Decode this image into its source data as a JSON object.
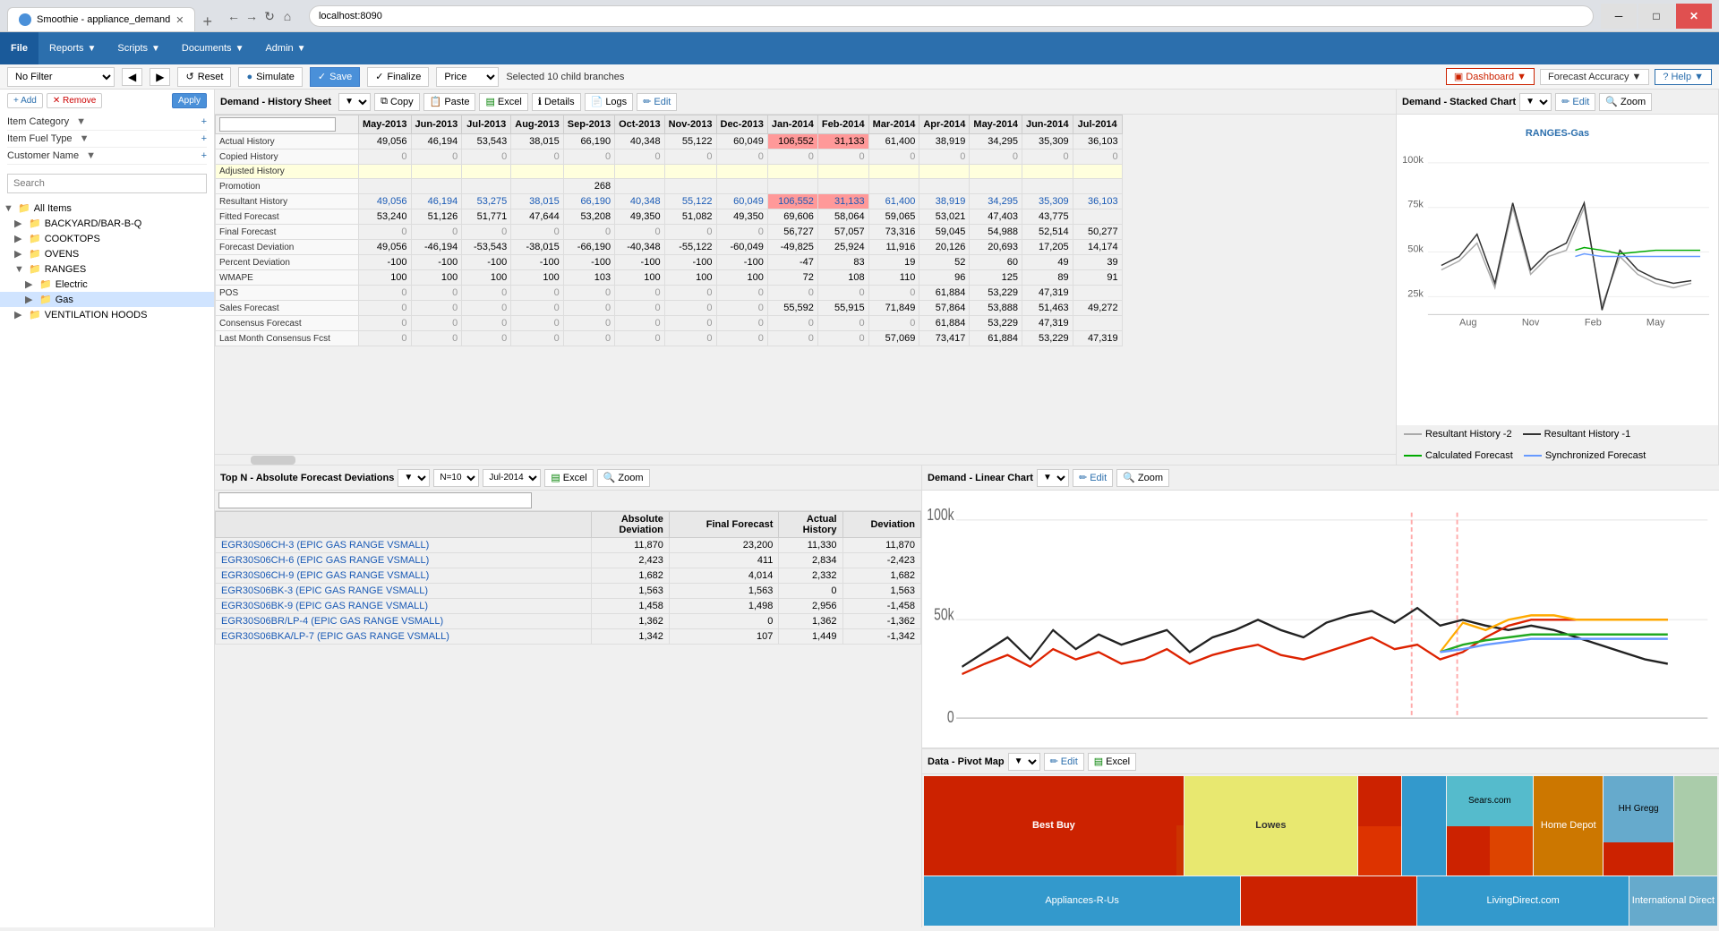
{
  "browser": {
    "tab_title": "Smoothie - appliance_demand",
    "url": "localhost:8090",
    "new_tab_label": "+"
  },
  "nav": {
    "logo": "File",
    "items": [
      {
        "label": "Reports",
        "dropdown": true
      },
      {
        "label": "Scripts",
        "dropdown": true
      },
      {
        "label": "Documents",
        "dropdown": true
      },
      {
        "label": "Admin",
        "dropdown": true
      }
    ]
  },
  "filter_bar": {
    "filter_value": "No Filter",
    "back_arrow": "◀",
    "forward_arrow": "▶",
    "reset_label": "Reset",
    "simulate_label": "Simulate",
    "save_label": "Save",
    "finalize_label": "Finalize",
    "price_label": "Price",
    "branches_label": "Selected 10 child branches",
    "dashboard_label": "Dashboard",
    "forecast_accuracy_label": "Forecast Accuracy",
    "help_label": "Help"
  },
  "sidebar": {
    "add_label": "+ Add",
    "remove_label": "✕ Remove",
    "apply_label": "Apply",
    "search_placeholder": "Search",
    "filters": [
      {
        "label": "Item Category",
        "dropdown": true
      },
      {
        "label": "Item Fuel Type",
        "dropdown": true
      },
      {
        "label": "Customer Name",
        "dropdown": true
      }
    ],
    "tree": [
      {
        "label": "All Items",
        "level": 0,
        "expanded": true,
        "type": "root"
      },
      {
        "label": "BACKYARD/BAR-B-Q",
        "level": 1,
        "expanded": false,
        "type": "folder"
      },
      {
        "label": "COOKTOPS",
        "level": 1,
        "expanded": false,
        "type": "folder"
      },
      {
        "label": "OVENS",
        "level": 1,
        "expanded": false,
        "type": "folder"
      },
      {
        "label": "RANGES",
        "level": 1,
        "expanded": true,
        "type": "folder"
      },
      {
        "label": "Electric",
        "level": 2,
        "expanded": false,
        "type": "folder"
      },
      {
        "label": "Gas",
        "level": 2,
        "expanded": false,
        "type": "folder",
        "selected": true
      },
      {
        "label": "VENTILATION HOODS",
        "level": 1,
        "expanded": false,
        "type": "folder"
      }
    ]
  },
  "history_sheet": {
    "title": "Demand - History Sheet",
    "copy_label": "Copy",
    "paste_label": "Paste",
    "excel_label": "Excel",
    "details_label": "Details",
    "logs_label": "Logs",
    "edit_label": "Edit",
    "columns": [
      "",
      "May-2013",
      "Jun-2013",
      "Jul-2013",
      "Aug-2013",
      "Sep-2013",
      "Oct-2013",
      "Nov-2013",
      "Dec-2013",
      "Jan-2014",
      "Feb-2014",
      "Mar-2014",
      "Apr-2014",
      "May-2014",
      "Jun-2014",
      "Jul-2014"
    ],
    "rows": [
      {
        "label": "Actual History",
        "values": [
          "49,056",
          "46,194",
          "53,543",
          "38,015",
          "66,190",
          "40,348",
          "55,122",
          "60,049",
          "106,552",
          "31,133",
          "61,400",
          "38,919",
          "34,295",
          "35,309",
          "36,103"
        ],
        "style": ""
      },
      {
        "label": "Copied History",
        "values": [
          "0",
          "0",
          "0",
          "0",
          "0",
          "0",
          "0",
          "0",
          "0",
          "0",
          "0",
          "0",
          "0",
          "0",
          "0"
        ],
        "style": ""
      },
      {
        "label": "Adjusted History",
        "values": [
          "",
          "",
          "",
          "",
          "",
          "",
          "",
          "",
          "",
          "",
          "",
          "",
          "",
          "",
          ""
        ],
        "style": "yellow"
      },
      {
        "label": "Promotion",
        "values": [
          "",
          "",
          "",
          "",
          "268",
          "",
          "",
          "",
          "",
          "",
          "",
          "",
          "",
          "",
          ""
        ],
        "style": ""
      },
      {
        "label": "Resultant History",
        "values": [
          "49,056",
          "46,194",
          "53,275",
          "38,015",
          "66,190",
          "40,348",
          "55,122",
          "60,049",
          "106,552",
          "31,133",
          "61,400",
          "38,919",
          "34,295",
          "35,309",
          "36,103"
        ],
        "style": "blue"
      },
      {
        "label": "Fitted Forecast",
        "values": [
          "53,240",
          "51,126",
          "51,771",
          "47,644",
          "53,208",
          "49,350",
          "",
          "",
          "69,606",
          "58,064",
          "59,065",
          "53,021",
          "47,403",
          "43,775",
          ""
        ],
        "style": ""
      },
      {
        "label": "Final Forecast",
        "values": [
          "0",
          "0",
          "0",
          "0",
          "0",
          "0",
          "0",
          "0",
          "56,727",
          "57,057",
          "73,316",
          "59,045",
          "54,988",
          "52,514",
          "50,277"
        ],
        "style": ""
      },
      {
        "label": "Forecast Deviation",
        "values": [
          "49,056",
          "-46,194",
          "-53,543",
          "-38,015",
          "-66,190",
          "-40,348",
          "-55,122",
          "-60,049",
          "-49,825",
          "25,924",
          "11,916",
          "20,126",
          "20,693",
          "17,205",
          "14,174"
        ],
        "style": ""
      },
      {
        "label": "Percent Deviation",
        "values": [
          "-100",
          "-100",
          "-100",
          "-100",
          "-100",
          "-100",
          "-100",
          "-100",
          "-47",
          "83",
          "19",
          "52",
          "60",
          "49",
          "39"
        ],
        "style": ""
      },
      {
        "label": "WMAPE",
        "values": [
          "100",
          "100",
          "100",
          "100",
          "103",
          "100",
          "100",
          "100",
          "72",
          "108",
          "110",
          "96",
          "125",
          "89",
          "91"
        ],
        "style": ""
      },
      {
        "label": "POS",
        "values": [
          "0",
          "0",
          "0",
          "0",
          "0",
          "0",
          "0",
          "0",
          "0",
          "0",
          "0",
          "61,884",
          "53,229",
          "47,319",
          ""
        ],
        "style": ""
      },
      {
        "label": "Sales Forecast",
        "values": [
          "0",
          "0",
          "0",
          "0",
          "0",
          "0",
          "0",
          "0",
          "55,592",
          "55,915",
          "71,849",
          "57,864",
          "53,888",
          "51,463",
          "49,272"
        ],
        "style": ""
      },
      {
        "label": "Consensus Forecast",
        "values": [
          "0",
          "0",
          "0",
          "0",
          "0",
          "0",
          "0",
          "0",
          "0",
          "0",
          "0",
          "61,884",
          "53,229",
          "47,319",
          ""
        ],
        "style": ""
      },
      {
        "label": "Last Month Consensus Fcst",
        "values": [
          "0",
          "0",
          "0",
          "0",
          "0",
          "0",
          "0",
          "0",
          "0",
          "0",
          "57,069",
          "73,417",
          "61,884",
          "53,229",
          "47,319"
        ],
        "style": ""
      }
    ]
  },
  "stacked_chart": {
    "title": "Demand - Stacked Chart",
    "edit_label": "Edit",
    "zoom_label": "Zoom",
    "chart_title": "RANGES-Gas",
    "y_labels": [
      "100k",
      "75k",
      "50k",
      "25k"
    ],
    "x_labels": [
      "Aug",
      "Nov",
      "Feb",
      "May"
    ],
    "legend": [
      {
        "label": "Resultant History -2",
        "color": "#999999"
      },
      {
        "label": "Resultant History -1",
        "color": "#333333"
      },
      {
        "label": "Calculated Forecast",
        "color": "#00aa00"
      },
      {
        "label": "Synchronized Forecast",
        "color": "#6699ff"
      }
    ]
  },
  "deviations": {
    "title": "Top Absolute Forecast Deviations",
    "top_n_label": "Top N - Absolute Forecast Deviations",
    "n_label": "N=10",
    "date_label": "Jul-2014",
    "excel_label": "Excel",
    "zoom_label": "Zoom",
    "search_placeholder": "",
    "columns": [
      "",
      "Absolute\nDeviation",
      "Final Forecast",
      "Actual\nHistory",
      "Deviation"
    ],
    "rows": [
      {
        "name": "EGR30S06CH-3 (EPIC GAS RANGE VSMALL)",
        "abs_dev": "11,870",
        "final_fcst": "23,200",
        "actual": "11,330",
        "deviation": "11,870"
      },
      {
        "name": "EGR30S06CH-6 (EPIC GAS RANGE VSMALL)",
        "abs_dev": "2,423",
        "final_fcst": "411",
        "actual": "2,834",
        "deviation": "-2,423"
      },
      {
        "name": "EGR30S06CH-9 (EPIC GAS RANGE VSMALL)",
        "abs_dev": "1,682",
        "final_fcst": "4,014",
        "actual": "2,332",
        "deviation": "1,682"
      },
      {
        "name": "EGR30S06BK-3 (EPIC GAS RANGE VSMALL)",
        "abs_dev": "1,563",
        "final_fcst": "1,563",
        "actual": "0",
        "deviation": "1,563"
      },
      {
        "name": "EGR30S06BK-9 (EPIC GAS RANGE VSMALL)",
        "abs_dev": "1,458",
        "final_fcst": "1,498",
        "actual": "2,956",
        "deviation": "-1,458"
      },
      {
        "name": "EGR30S06BR/LP-4 (EPIC GAS RANGE VSMALL)",
        "abs_dev": "1,362",
        "final_fcst": "0",
        "actual": "1,362",
        "deviation": "-1,362"
      },
      {
        "name": "EGR30S06BKA/LP-7 (EPIC GAS RANGE VSMALL)",
        "abs_dev": "1,342",
        "final_fcst": "107",
        "actual": "1,449",
        "deviation": "-1,342"
      }
    ]
  },
  "linear_chart": {
    "title": "Demand - Linear Chart",
    "edit_label": "Edit",
    "zoom_label": "Zoom",
    "y_labels": [
      "100k",
      "50k",
      "0"
    ]
  },
  "pivot_map": {
    "title": "Data - Pivot Map",
    "edit_label": "Edit",
    "excel_label": "Excel",
    "cells": [
      {
        "label": "Best Buy",
        "color": "#cc2200",
        "flex": 30
      },
      {
        "label": "",
        "color": "#cc3300",
        "flex": 5
      },
      {
        "label": "Lowes",
        "color": "#e8e870",
        "flex": 20
      },
      {
        "label": "",
        "color": "#cc2200",
        "flex": 5
      },
      {
        "label": "",
        "color": "#3399cc",
        "flex": 5
      },
      {
        "label": "Sears.com",
        "color": "#55bbcc",
        "flex": 10
      },
      {
        "label": "",
        "color": "#cc2200",
        "flex": 4
      },
      {
        "label": "Home Depot",
        "color": "#cc7700",
        "flex": 8
      },
      {
        "label": "HH Gregg",
        "color": "#66aacc",
        "flex": 8
      },
      {
        "label": "",
        "color": "#aaccaa",
        "flex": 5
      }
    ],
    "bottom_cells": [
      {
        "label": "Appliances-R-Us",
        "color": "#3399cc",
        "flex": 18
      },
      {
        "label": "",
        "color": "#cc2200",
        "flex": 10
      },
      {
        "label": "LivingDirect.com",
        "color": "#3399cc",
        "flex": 12
      },
      {
        "label": "International Direct",
        "color": "#66aacc",
        "flex": 5
      }
    ]
  }
}
